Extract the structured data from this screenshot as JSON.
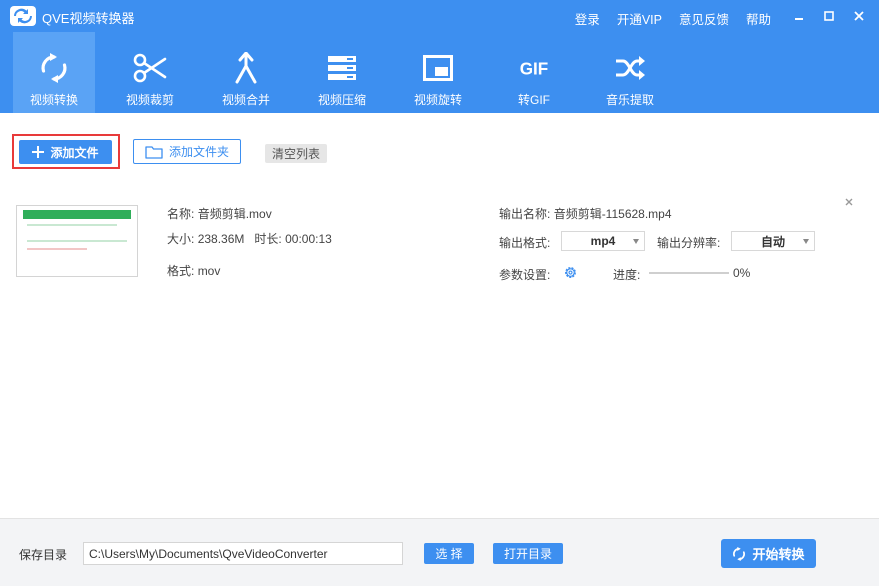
{
  "app": {
    "title": "QVE视频转换器"
  },
  "top_links": [
    "登录",
    "开通VIP",
    "意见反馈",
    "帮助"
  ],
  "toolbar": {
    "active": 0,
    "items": [
      {
        "label": "视频转换",
        "icon": "convert-icon"
      },
      {
        "label": "视频裁剪",
        "icon": "scissors-icon"
      },
      {
        "label": "视频合并",
        "icon": "merge-icon"
      },
      {
        "label": "视频压缩",
        "icon": "compress-icon"
      },
      {
        "label": "视频旋转",
        "icon": "rotate-icon"
      },
      {
        "label": "转GIF",
        "icon": "gif-icon"
      },
      {
        "label": "音乐提取",
        "icon": "shuffle-icon"
      }
    ]
  },
  "actions": {
    "add_file": "添加文件",
    "add_folder": "添加文件夹",
    "clear_list": "清空列表"
  },
  "file": {
    "name_label": "名称:",
    "name": "音频剪辑.mov",
    "size_label": "大小:",
    "size": "238.36M",
    "duration_label": "时长:",
    "duration": "00:00:13",
    "format_label": "格式:",
    "format": "mov",
    "output_name_label": "输出名称:",
    "output_name": "音频剪辑-115628.mp4",
    "output_format_label": "输出格式:",
    "output_format": "mp4",
    "output_resolution_label": "输出分辨率:",
    "output_resolution": "自动",
    "params_label": "参数设置:",
    "progress_label": "进度:",
    "progress_text": "0%",
    "progress_value": 0
  },
  "footer": {
    "save_dir_label": "保存目录",
    "save_path": "C:\\Users\\My\\Documents\\QveVideoConverter",
    "choose": "选 择",
    "open_dir": "打开目录",
    "start": "开始转换"
  },
  "colors": {
    "accent": "#3d8ff0",
    "active_tab": "#5aa3f5",
    "highlight": "#e83a3a"
  }
}
